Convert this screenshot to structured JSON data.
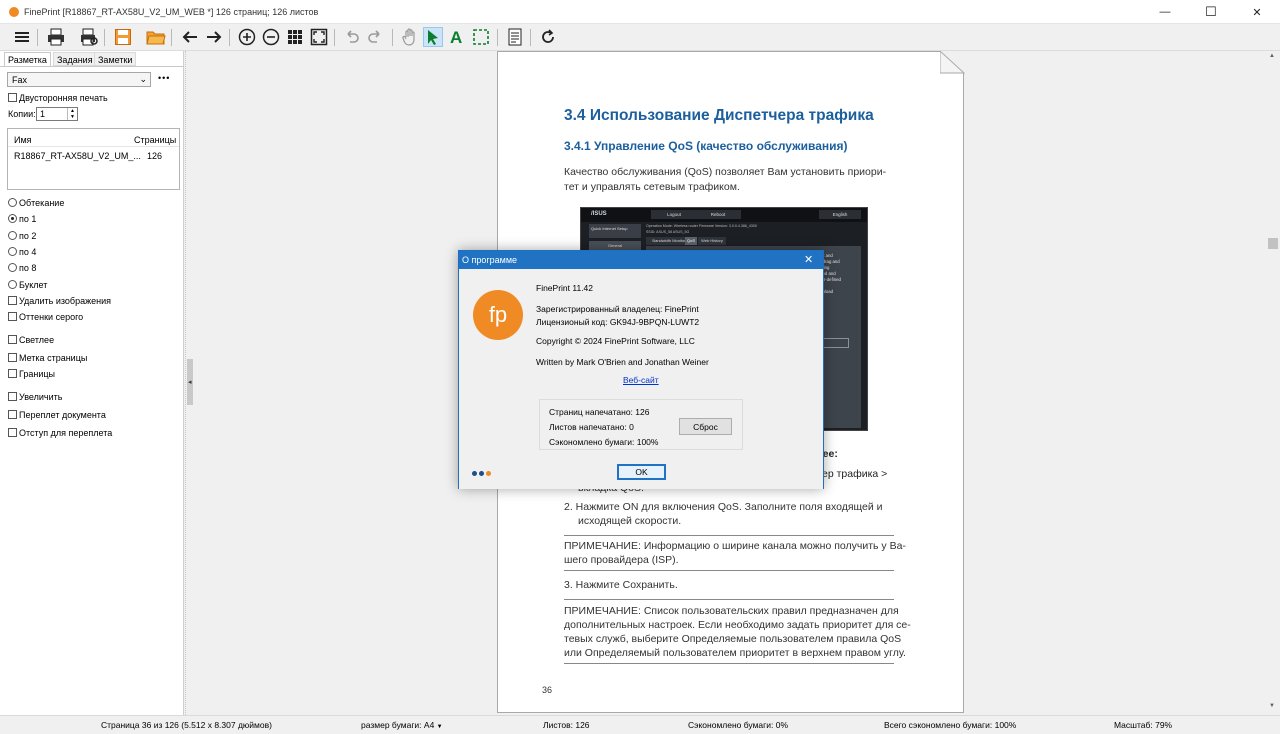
{
  "window": {
    "title": "FinePrint [R18867_RT-AX58U_V2_UM_WEB *] 126 страниц; 126 листов",
    "controls": {
      "minimize": "—",
      "maximize": "☐",
      "close": "✕"
    }
  },
  "toolbar": {
    "icons": [
      "menu-icon",
      "print-icon",
      "print-preview-icon",
      "save-icon",
      "open-folder-icon",
      "back-icon",
      "forward-icon",
      "zoom-in-icon",
      "zoom-out-icon",
      "grid-icon",
      "fit-page-icon",
      "undo-icon",
      "redo-icon",
      "hand-icon",
      "pointer-icon",
      "text-tool-icon",
      "select-tool-icon",
      "document-icon",
      "refresh-icon"
    ]
  },
  "left_panel": {
    "tabs": [
      "Разметка",
      "Задания",
      "Заметки"
    ],
    "active_tab": "Разметка",
    "printer": "Fax",
    "more": "•••",
    "duplex_label": "Двусторонняя печать",
    "copies_label": "Копии:",
    "copies_value": "1",
    "jobs_table": {
      "headers": [
        "Имя",
        "Страницы"
      ],
      "rows": [
        [
          "R18867_RT-AX58U_V2_UM_...",
          "126"
        ]
      ]
    },
    "layout_options": [
      {
        "label": "Обтекание",
        "selected": false
      },
      {
        "label": "по 1",
        "selected": true
      },
      {
        "label": "по 2",
        "selected": false
      },
      {
        "label": "по 4",
        "selected": false
      },
      {
        "label": "по 8",
        "selected": false
      },
      {
        "label": "Буклет",
        "selected": false
      }
    ],
    "checkboxes": [
      "Удалить изображения",
      "Оттенки серого",
      "Светлее",
      "Метка страницы",
      "Границы",
      "Увеличить",
      "Переплет документа",
      "Отступ для переплета"
    ]
  },
  "document": {
    "heading": "3.4   Использование Диспетчера трафика",
    "subheading": "3.4.1 Управление QoS (качество обслуживания)",
    "intro_line1": "Качество обслуживания (QoS) позволяет Вам установить приори-",
    "intro_line2": "тет и управлять сетевым трафиком.",
    "screenshot": {
      "logo": "/ISUS",
      "buttons": [
        "Logout",
        "Reboot",
        "English"
      ],
      "sidebar_items": [
        "Quick Internet Setup",
        "General"
      ],
      "tabs": [
        "Bandwidth Monitor",
        "QoS",
        "Web History"
      ],
      "status_line": "Operation Mode: Wireless router  Firmware Version: 3.0.0.4.386_4300",
      "ssid_line": "SSID: ASUS_58  ASUS_5G",
      "panel_text": [
        "root and",
        "ct, drag and",
        "ritizing",
        "eived and",
        "user-defined",
        "h.",
        "ownload"
      ]
    },
    "behind_dialog_1": "дее:",
    "behind_dialog_2": "ер трафика >",
    "behind_dialog_3": "вкладка QoS.",
    "step2_line1": "2.  Нажмите ON для включения QoS. Заполните поля входящей и",
    "step2_line2": "исходящей скорости.",
    "note1_line1": "ПРИМЕЧАНИЕ:  Информацию о ширине канала можно получить у Ва-",
    "note1_line2": "шего провайдера (ISP).",
    "step3": "3.  Нажмите Сохранить.",
    "note2_line1": "ПРИМЕЧАНИЕ: Список пользовательских правил предназначен для",
    "note2_line2": "дополнительных настроек. Если необходимо задать приоритет для се-",
    "note2_line3": "тевых служб, выберите Определяемые пользователем правила QoS",
    "note2_line4": "или Определяемый пользователем приоритет в верхнем правом углу.",
    "page_number": "36",
    "heading_color": "#1b5f9e"
  },
  "dialog": {
    "title": "О программе",
    "logo_text": "fp",
    "version": "FinePrint 11.42",
    "owner": "Зарегистрированный владелец:  FinePrint",
    "license": "Лицензионый код:  GK94J-9BPQN-LUWT2",
    "copyright": "Copyright © 2024 FinePrint Software, LLC",
    "written_by": "Written by Mark O'Brien and Jonathan Weiner",
    "website": "Веб-сайт",
    "pages_printed": "Страниц напечатано: 126",
    "sheets_printed": "Листов напечатано:   0",
    "paper_saved": "Сэкономлено бумаги: 100%",
    "reset_button": "Сброс",
    "ok_button": "OK",
    "accent_color": "#1f73c2",
    "logo_color": "#f08a24"
  },
  "status_bar": {
    "page_info": "Страница 36 из 126 (5.512 x 8.307 дюймов)",
    "paper_size": "размер бумаги: A4",
    "sheets": "Листов: 126",
    "saved": "Сэкономлено бумаги: 0%",
    "total_saved": "Всего сэкономлено бумаги: 100%",
    "zoom": "Масштаб: 79%"
  }
}
